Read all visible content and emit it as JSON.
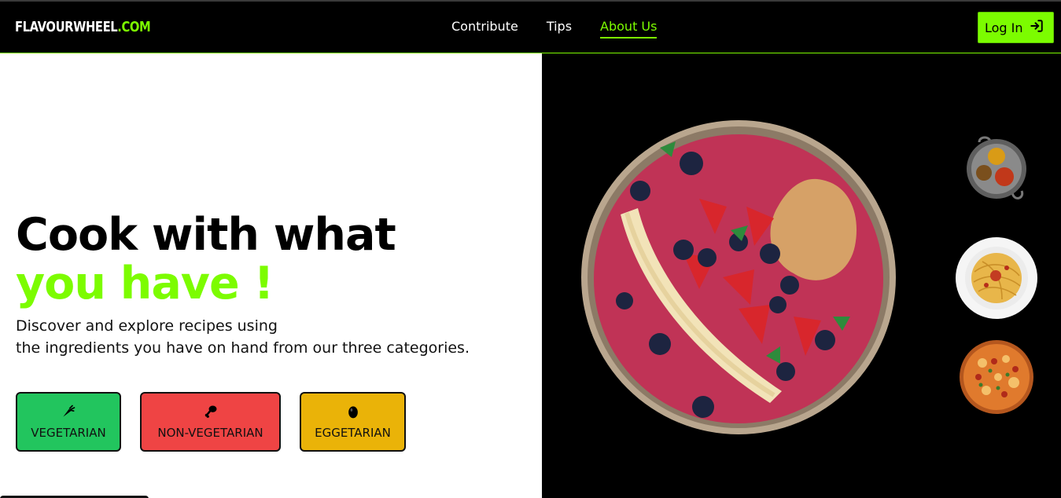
{
  "nav": {
    "logo_main": "FLAVOURWHEEL",
    "logo_accent": ".COM",
    "links": [
      {
        "label": "Contribute"
      },
      {
        "label": "Tips"
      },
      {
        "label": "About Us"
      }
    ],
    "active_link": "About Us",
    "login_label": "Log In",
    "login_icon": "sign-in-icon"
  },
  "hero": {
    "headline_line1": "Cook with what",
    "headline_line2": "you have !",
    "subtext_line1": "Discover and explore recipes using",
    "subtext_line2": "the ingredients you have on hand from our three categories.",
    "categories": [
      {
        "label": "VEGETARIAN",
        "icon": "carrot-icon",
        "color": "#22c55e"
      },
      {
        "label": "NON-VEGETARIAN",
        "icon": "drumstick-icon",
        "color": "#ef4444"
      },
      {
        "label": "EGGETARIAN",
        "icon": "egg-icon",
        "color": "#eab308"
      }
    ]
  },
  "images": {
    "main": "smoothie-bowl-image",
    "side": [
      "spices-pan-image",
      "spaghetti-plate-image",
      "pizza-image"
    ]
  },
  "colors": {
    "accent": "#7cfc00",
    "background_dark": "#000000"
  }
}
